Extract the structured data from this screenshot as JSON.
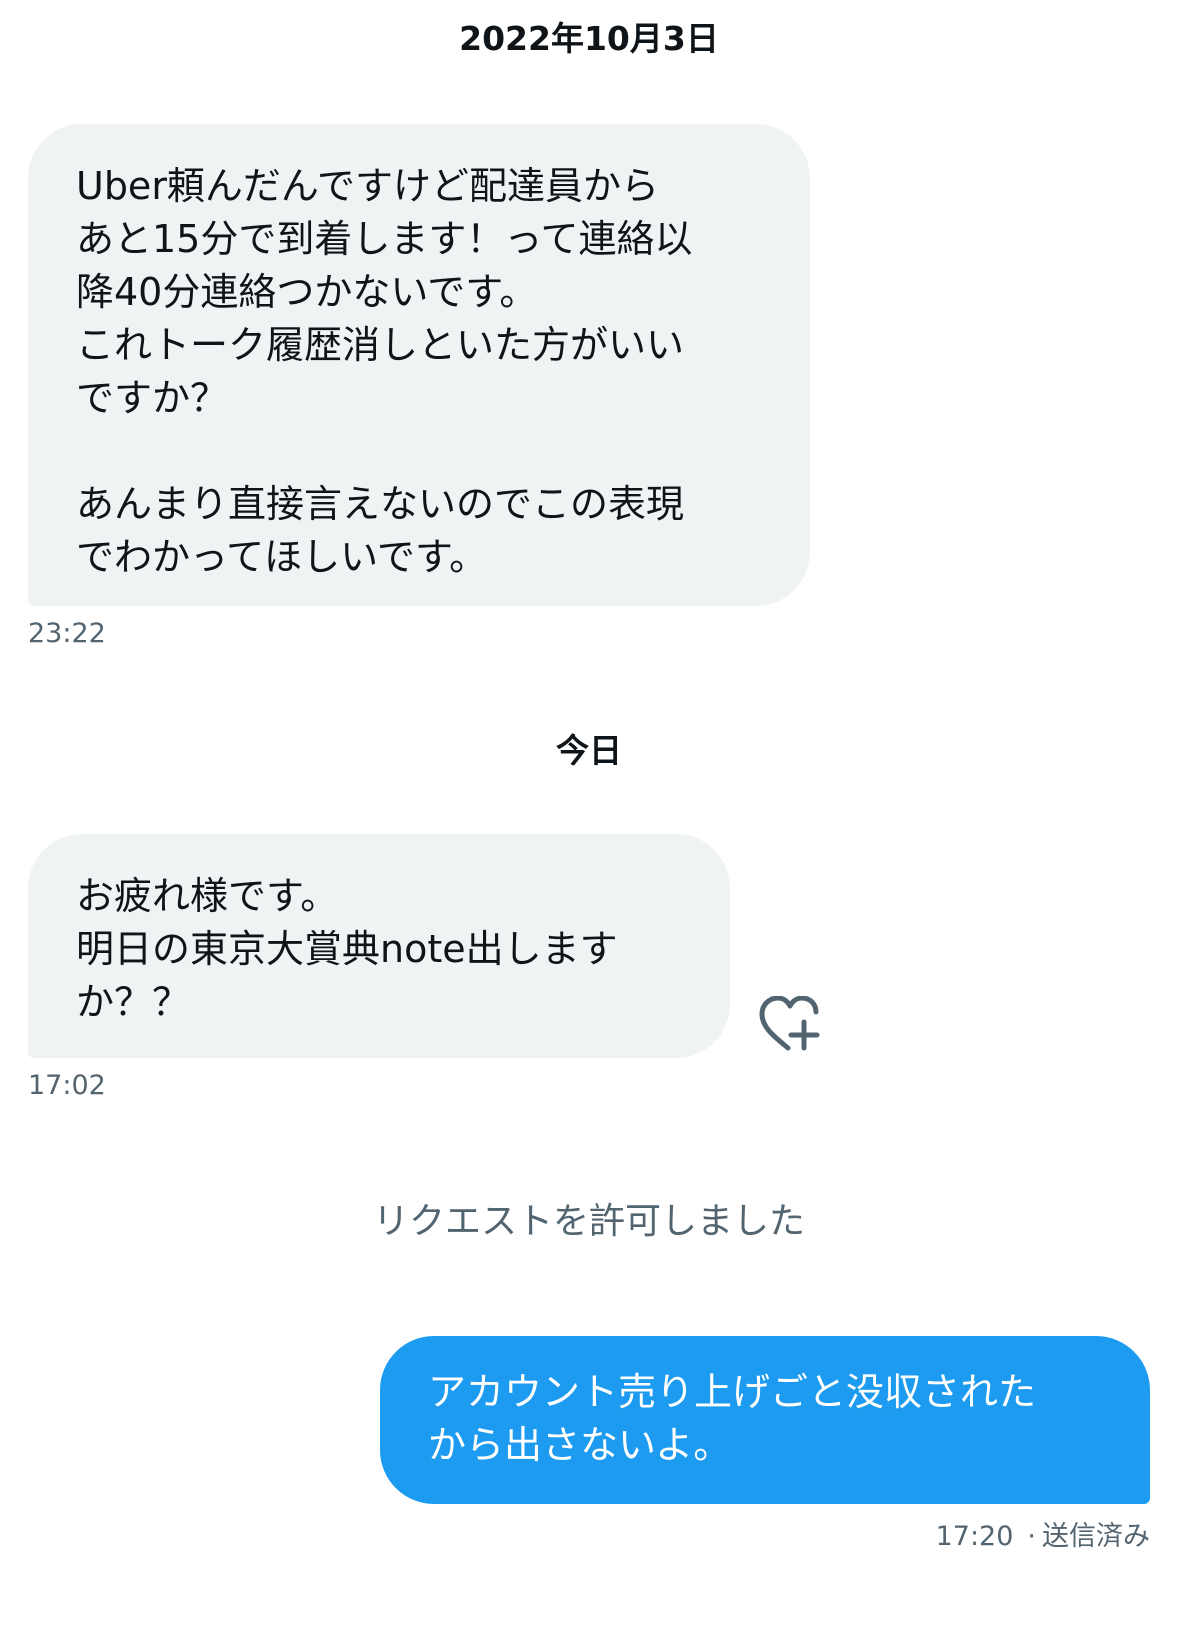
{
  "conversation": {
    "date_separator_1": "2022年10月3日",
    "message_1": {
      "text": "Uber頼んだんですけど配達員から\nあと15分で到着します！って連絡以\n降40分連絡つかないです。\nこれトーク履歴消しといた方がいい\nですか？\n\nあんまり直接言えないのでこの表現\nでわかってほしいです。",
      "time": "23:22"
    },
    "date_separator_2": "今日",
    "message_2": {
      "text": "お疲れ様です。\n明日の東京大賞典note出します\nか？？",
      "time": "17:02",
      "reaction_icon": "heart-plus-icon"
    },
    "system_note": "リクエストを許可しました",
    "message_3": {
      "text": "アカウント売り上げごと没収された\nから出さないよ。",
      "time": "17:20",
      "separator": "·",
      "status": "送信済み"
    }
  },
  "colors": {
    "received_bubble": "#eff3f4",
    "sent_bubble": "#1d9bf0",
    "secondary_text": "#536471"
  }
}
